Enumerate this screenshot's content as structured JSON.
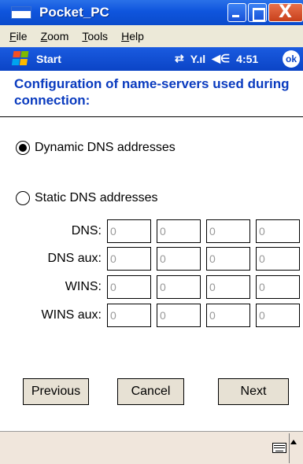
{
  "window": {
    "title": "Pocket_PC",
    "close_symbol": "X"
  },
  "menu": {
    "items": [
      {
        "label": "File",
        "accel": "F",
        "rest": "ile"
      },
      {
        "label": "Zoom",
        "accel": "Z",
        "rest": "oom"
      },
      {
        "label": "Tools",
        "accel": "T",
        "rest": "ools"
      },
      {
        "label": "Help",
        "accel": "H",
        "rest": "elp"
      }
    ]
  },
  "status": {
    "start_label": "Start",
    "connectivity_icon": "⇄",
    "signal_icon": "Y.ıl",
    "volume_icon": "◀∈",
    "time": "4:51",
    "ok_label": "ok"
  },
  "page": {
    "caption": "Configuration of name-servers used during connection:"
  },
  "dns_mode": {
    "dynamic_label": "Dynamic DNS addresses",
    "static_label": "Static DNS addresses",
    "selected": "dynamic"
  },
  "servers": {
    "rows": [
      {
        "label": "DNS:",
        "octets": [
          "0",
          "0",
          "0",
          "0"
        ]
      },
      {
        "label": "DNS aux:",
        "octets": [
          "0",
          "0",
          "0",
          "0"
        ]
      },
      {
        "label": "WINS:",
        "octets": [
          "0",
          "0",
          "0",
          "0"
        ]
      },
      {
        "label": "WINS aux:",
        "octets": [
          "0",
          "0",
          "0",
          "0"
        ]
      }
    ]
  },
  "buttons": {
    "previous": "Previous",
    "cancel": "Cancel",
    "next": "Next"
  },
  "icons": {
    "app": "window-icon",
    "start": "windows-flag-icon",
    "keyboard": "keyboard-icon"
  },
  "colors": {
    "title_blue": "#0f55dd",
    "caption_blue": "#0a3bbf",
    "field_text": "#999999"
  }
}
